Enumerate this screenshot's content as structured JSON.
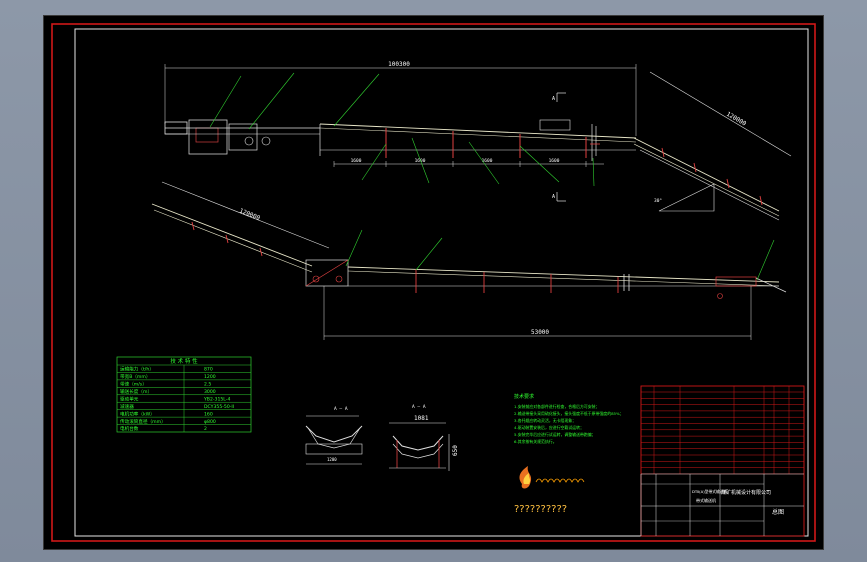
{
  "drawing": {
    "dims": {
      "upper_length": "100300",
      "upper_incline": "120000",
      "lower_incline": "120000",
      "lower_length": "53000",
      "span_labels": [
        "1600",
        "1600",
        "1600",
        "1600"
      ],
      "angle": "30°",
      "section_label": "A — A",
      "section_width": "1081",
      "section_height": "650"
    },
    "views": {
      "upper_section_marks": [
        "A",
        "A"
      ]
    },
    "tech_table": {
      "title": "技 术 特 性",
      "rows": [
        [
          "运输能力（t/h）",
          "870"
        ],
        [
          "带宽B（mm）",
          "1200"
        ],
        [
          "带速（m/s）",
          "2.5"
        ],
        [
          "输送长度（m）",
          "3000"
        ],
        [
          "驱动单元",
          "YB2-315L-4"
        ],
        [
          "减速器",
          "DCY355-50-II"
        ],
        [
          "电机功率（kW）",
          "160"
        ],
        [
          "传动滚筒直径（mm）",
          "φ800"
        ],
        [
          "电机台数",
          "2"
        ]
      ]
    },
    "notes": {
      "title": "技术要求",
      "lines": [
        "1.安装前应对各部件进行检查，合格后方可安装；",
        "2.输送带接头采用硫化接头，接头强度不低于原带强度的85%；",
        "3.各托辊应转动灵活，无卡阻现象；",
        "4.驱动装置安装后，应进行空载试运转；",
        "5.安装完毕后应进行试运转，调整输送带跑偏；",
        "6.其余按有关规范执行。"
      ]
    },
    "watermark": "??????????",
    "title_block": {
      "drawing_title": "总图",
      "company": "煤矿机械设计有限公司",
      "model": "DTⅡ(A)型带式输送机",
      "project": "带式输送机"
    }
  }
}
